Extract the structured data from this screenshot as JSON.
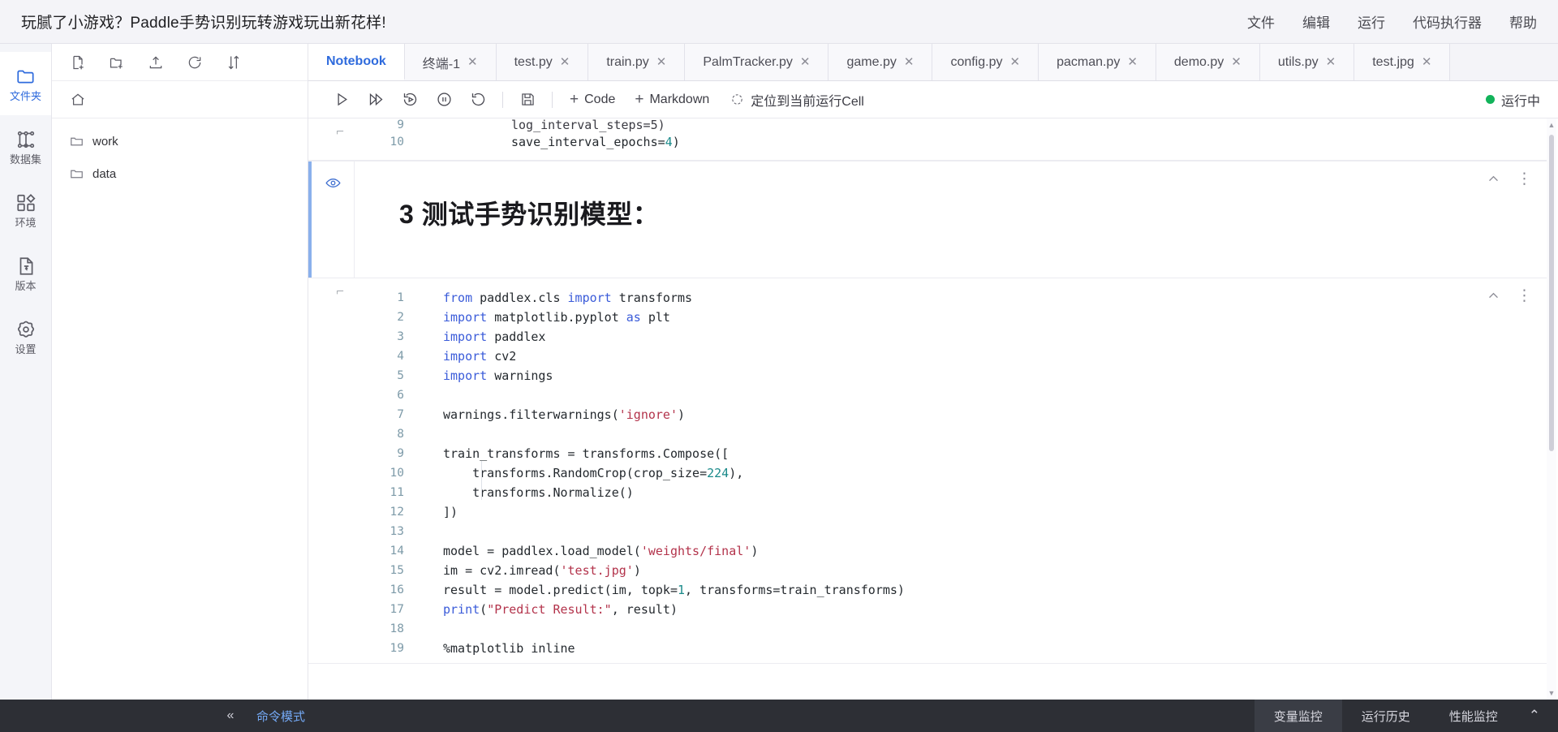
{
  "topbar": {
    "title": "玩腻了小游戏？Paddle手势识别玩转游戏玩出新花样!",
    "menu": [
      {
        "label": "文件"
      },
      {
        "label": "编辑"
      },
      {
        "label": "运行"
      },
      {
        "label": "代码执行器"
      },
      {
        "label": "帮助"
      }
    ]
  },
  "rail": {
    "items": [
      {
        "label": "文件夹",
        "icon": "folder-icon",
        "active": true
      },
      {
        "label": "数据集",
        "icon": "dataset-icon",
        "active": false
      },
      {
        "label": "环境",
        "icon": "environment-icon",
        "active": false
      },
      {
        "label": "版本",
        "icon": "version-icon",
        "active": false
      },
      {
        "label": "设置",
        "icon": "settings-gear-icon",
        "active": false
      }
    ]
  },
  "filepanel": {
    "toolbar": [
      {
        "icon": "new-file-icon"
      },
      {
        "icon": "new-folder-icon"
      },
      {
        "icon": "upload-icon"
      },
      {
        "icon": "refresh-icon"
      },
      {
        "icon": "sort-icon"
      }
    ],
    "breadcrumb_icon": "home-icon",
    "files": [
      {
        "name": "work",
        "icon": "folder-icon"
      },
      {
        "name": "data",
        "icon": "folder-icon"
      }
    ]
  },
  "tabs": [
    {
      "label": "Notebook",
      "active": true,
      "closable": false
    },
    {
      "label": "终端-1",
      "active": false,
      "closable": true
    },
    {
      "label": "test.py",
      "active": false,
      "closable": true
    },
    {
      "label": "train.py",
      "active": false,
      "closable": true
    },
    {
      "label": "PalmTracker.py",
      "active": false,
      "closable": true
    },
    {
      "label": "game.py",
      "active": false,
      "closable": true
    },
    {
      "label": "config.py",
      "active": false,
      "closable": true
    },
    {
      "label": "pacman.py",
      "active": false,
      "closable": true
    },
    {
      "label": "demo.py",
      "active": false,
      "closable": true
    },
    {
      "label": "utils.py",
      "active": false,
      "closable": true
    },
    {
      "label": "test.jpg",
      "active": false,
      "closable": true
    }
  ],
  "tab_close_glyph": "✕",
  "nbtoolbar": {
    "buttons": [
      {
        "icon": "run-cell-icon",
        "title": "运行"
      },
      {
        "icon": "run-all-icon",
        "title": "全部运行"
      },
      {
        "icon": "restart-run-all-icon",
        "title": "重启并运行"
      },
      {
        "icon": "interrupt-icon",
        "title": "中断"
      },
      {
        "icon": "restart-kernel-icon",
        "title": "重启"
      },
      {
        "icon": "save-icon",
        "title": "保存"
      }
    ],
    "add_code_label": "Code",
    "add_markdown_label": "Markdown",
    "plus_glyph": "+",
    "locate_label": "定位到当前运行Cell",
    "locate_icon": "locate-target-icon",
    "kernel_status_label": "运行中",
    "kernel_status_color": "#12b35a"
  },
  "notebook": {
    "cell_top_partial": {
      "type": "code",
      "lines": [
        {
          "no": "9",
          "text": "log_interval_steps=5)",
          "clipped": true
        },
        {
          "no": "10",
          "text": "save_interval_epochs=4)"
        }
      ]
    },
    "markdown_cell": {
      "type": "markdown",
      "heading": "3 测试手势识别模型：",
      "eye_icon": "eye-icon",
      "collapse_icon": "chevron-up-icon",
      "menu_icon": "kebab-menu-icon"
    },
    "code_cell": {
      "type": "code",
      "collapse_icon": "chevron-up-icon",
      "menu_icon": "kebab-menu-icon",
      "lines": [
        {
          "no": "1",
          "text": "from paddlex.cls import transforms"
        },
        {
          "no": "2",
          "text": "import matplotlib.pyplot as plt"
        },
        {
          "no": "3",
          "text": "import paddlex"
        },
        {
          "no": "4",
          "text": "import cv2"
        },
        {
          "no": "5",
          "text": "import warnings"
        },
        {
          "no": "6",
          "text": ""
        },
        {
          "no": "7",
          "text": "warnings.filterwarnings('ignore')"
        },
        {
          "no": "8",
          "text": ""
        },
        {
          "no": "9",
          "text": "train_transforms = transforms.Compose(["
        },
        {
          "no": "10",
          "text": "    transforms.RandomCrop(crop_size=224),"
        },
        {
          "no": "11",
          "text": "    transforms.Normalize()"
        },
        {
          "no": "12",
          "text": "])"
        },
        {
          "no": "13",
          "text": ""
        },
        {
          "no": "14",
          "text": "model = paddlex.load_model('weights/final')"
        },
        {
          "no": "15",
          "text": "im = cv2.imread('test.jpg')"
        },
        {
          "no": "16",
          "text": "result = model.predict(im, topk=1, transforms=train_transforms)"
        },
        {
          "no": "17",
          "text": "print(\"Predict Result:\", result)"
        },
        {
          "no": "18",
          "text": ""
        },
        {
          "no": "19",
          "text": "%matplotlib inline"
        }
      ]
    },
    "scroll_up_glyph": "▲",
    "scroll_down_glyph": "▼"
  },
  "statusbar": {
    "collapse_glyph": "«",
    "mode_label": "命令模式",
    "right_items": [
      {
        "label": "变量监控",
        "boxed": true
      },
      {
        "label": "运行历史",
        "boxed": false
      },
      {
        "label": "性能监控",
        "boxed": false
      }
    ],
    "expand_glyph": "⌃"
  },
  "colors": {
    "accent_blue": "#2f6bdd",
    "topbar_bg": "#f4f4f8",
    "statusbar_bg": "#2d2f35",
    "mode_blue": "#74a9f5",
    "running_green": "#12b35a"
  }
}
